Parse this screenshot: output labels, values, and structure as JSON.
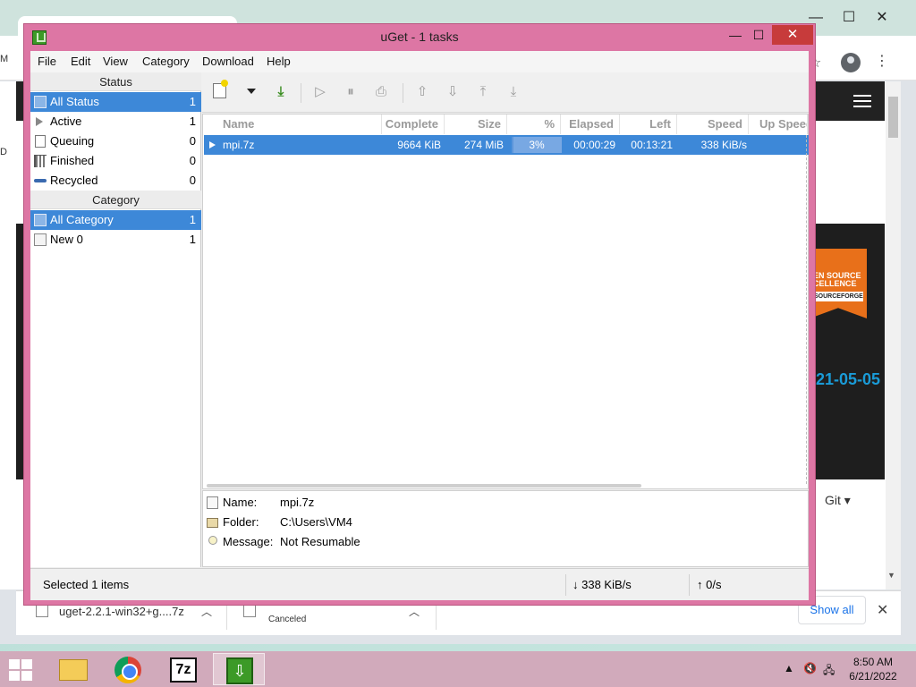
{
  "window": {
    "title": "uGet - 1 tasks",
    "minimize": "—",
    "maximize": "☐",
    "close": "✕"
  },
  "menu": [
    "File",
    "Edit",
    "View",
    "Category",
    "Download",
    "Help"
  ],
  "sidebar": {
    "status_header": "Status",
    "status_items": [
      {
        "label": "All Status",
        "count": "1"
      },
      {
        "label": "Active",
        "count": "1"
      },
      {
        "label": "Queuing",
        "count": "0"
      },
      {
        "label": "Finished",
        "count": "0"
      },
      {
        "label": "Recycled",
        "count": "0"
      }
    ],
    "category_header": "Category",
    "category_items": [
      {
        "label": "All Category",
        "count": "1"
      },
      {
        "label": "New 0",
        "count": "1"
      }
    ]
  },
  "columns": [
    "Name",
    "Complete",
    "Size",
    "%",
    "Elapsed",
    "Left",
    "Speed",
    "Up Speed"
  ],
  "tasks": [
    {
      "name": "mpi.7z",
      "complete": "9664 KiB",
      "size": "274 MiB",
      "percent": "3%",
      "progress": 0.03,
      "elapsed": "00:00:29",
      "left": "00:13:21",
      "speed": "338 KiB/s"
    }
  ],
  "details": {
    "name_label": "Name:",
    "name_value": "mpi.7z",
    "folder_label": "Folder:",
    "folder_value": "C:\\Users\\VM4",
    "message_label": "Message:",
    "message_value": "Not Resumable"
  },
  "statusbar": {
    "selected": "Selected 1 items",
    "down_speed": "↓ 338 KiB/s",
    "up_speed": "↑ 0/s"
  },
  "browser": {
    "osi_line1": "EN SOURCE",
    "osi_line2": "CELLENCE",
    "osi_line3": "SOURCEFORGE",
    "release_date": "21-05-05",
    "git_link": "Git ▾",
    "download1": "uget-2.2.1-win32+g....7z",
    "download2_status": "Canceled",
    "show_all": "Show all",
    "left_glyph1": "M",
    "left_glyph2": "D"
  },
  "taskbar": {
    "sevenz": "7z",
    "time": "8:50 AM",
    "date": "6/21/2022"
  },
  "colors": {
    "window_frame": "#dd76a4",
    "selection": "#3d88d8",
    "taskbar": "#d1aabb",
    "uget_green": "#3c9a27"
  }
}
